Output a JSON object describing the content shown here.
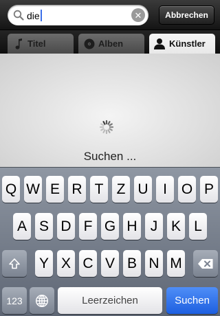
{
  "search": {
    "value": "die",
    "cancel_label": "Abbrechen",
    "clear_icon": "clear-x-icon"
  },
  "scope": {
    "tabs": [
      {
        "label": "Titel",
        "icon": "music-note-icon",
        "selected": false
      },
      {
        "label": "Alben",
        "icon": "album-disc-icon",
        "selected": false
      },
      {
        "label": "Künstler",
        "icon": "person-icon",
        "selected": true
      }
    ]
  },
  "status": {
    "text": "Suchen ..."
  },
  "keyboard": {
    "row1": [
      "Q",
      "W",
      "E",
      "R",
      "T",
      "Z",
      "U",
      "I",
      "O",
      "P"
    ],
    "row2": [
      "A",
      "S",
      "D",
      "F",
      "G",
      "H",
      "J",
      "K",
      "L"
    ],
    "row3": [
      "Y",
      "X",
      "C",
      "V",
      "B",
      "N",
      "M"
    ],
    "numbers_label": "123",
    "space_label": "Leerzeichen",
    "search_label": "Suchen",
    "shift_icon": "shift-arrow-icon",
    "backspace_icon": "backspace-icon",
    "globe_icon": "globe-icon"
  },
  "colors": {
    "search_key": "#1d5fe0",
    "caret": "#3a6ee8"
  }
}
